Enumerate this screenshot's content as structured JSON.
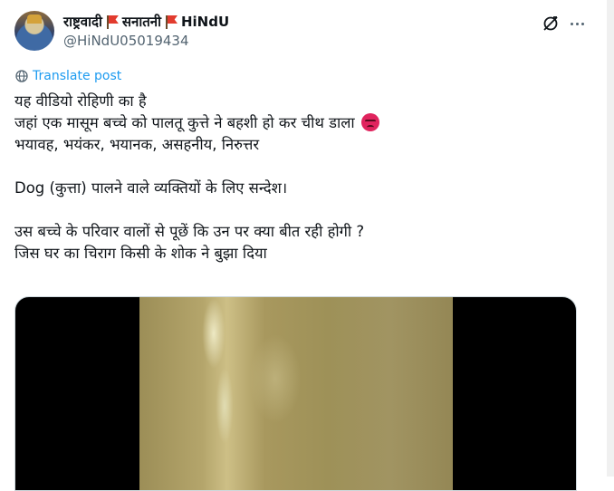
{
  "author": {
    "name_part1": "राष्ट्रवादी",
    "name_part2": "सनातनी",
    "name_part3": "HiNdU",
    "handle": "@HiNdU05019434",
    "icons": [
      "red-flag-icon",
      "red-flag-icon"
    ]
  },
  "header_actions": {
    "grok_icon": "grok-icon",
    "more_icon": "more-icon"
  },
  "translate": {
    "label": "Translate post",
    "color": "#1d9bf0"
  },
  "tweet": {
    "line1": "यह वीडियो रोहिणी का है",
    "line2": "जहां एक मासूम बच्चे को पालतू कुत्ते ने बहशी हो कर चीथ डाला",
    "line2_emoji": "angry-face-icon",
    "line3": "भयावह, भयंकर, भयानक, असहनीय, निरुत्तर",
    "line4": "Dog (कुत्ता) पालने वाले व्यक्तियों के लिए सन्देश।",
    "line5": "उस बच्चे के परिवार वालों से पूछें कि उन पर क्या बीत रही होगी ?",
    "line6": "जिस घर का चिराग किसी के शोक ने बुझा दिया"
  },
  "media": {
    "type": "video"
  }
}
